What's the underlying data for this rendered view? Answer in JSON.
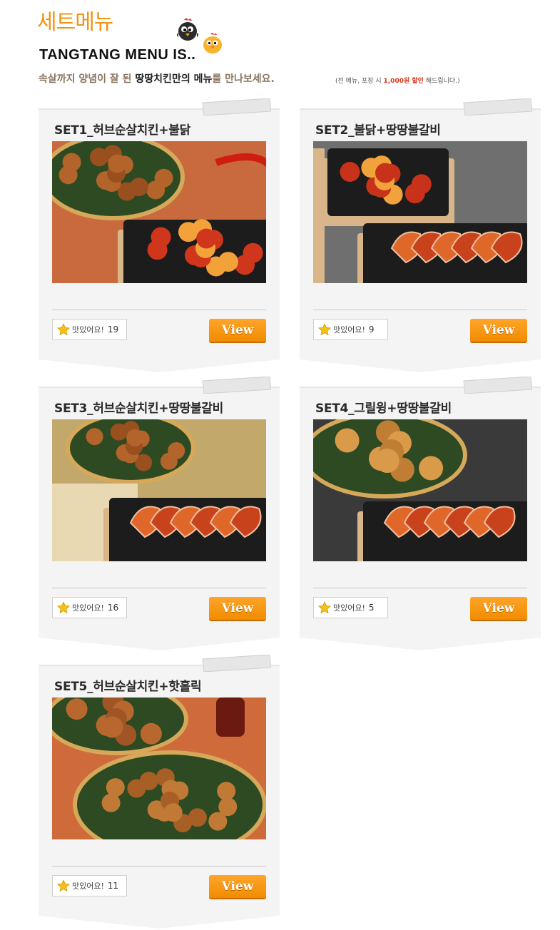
{
  "header": {
    "title": "세트메뉴",
    "subtitle": "TANGTANG MENU IS..",
    "tagline_prefix": "속살까지 양념이 잘 된 ",
    "tagline_brand": "땅땅치킨만의 메뉴",
    "tagline_suffix": "를 만나보세요.",
    "note_prefix": "(전 메뉴, 포장 시 ",
    "note_highlight": "1,000원 할인",
    "note_suffix": " 해드립니다.)"
  },
  "likes_label": "맛있어요!",
  "view_label": "View",
  "sets": [
    {
      "title": "SET1_허브순살치킨+불닭",
      "likes": "19",
      "photo": "boneless-and-fire"
    },
    {
      "title": "SET2_불닭+땅땅불갈비",
      "likes": "9",
      "photo": "fire-and-galbi"
    },
    {
      "title": "SET3_허브순살치킨+땅땅불갈비",
      "likes": "16",
      "photo": "boneless-and-galbi"
    },
    {
      "title": "SET4_그릴윙+땅땅불갈비",
      "likes": "5",
      "photo": "wing-and-galbi"
    },
    {
      "title": "SET5_허브순살치킨+핫홀릭",
      "likes": "11",
      "photo": "boneless-and-hot"
    }
  ],
  "colors": {
    "accent": "#f09416",
    "button": "#f08c00",
    "card": "#f4f4f4"
  }
}
